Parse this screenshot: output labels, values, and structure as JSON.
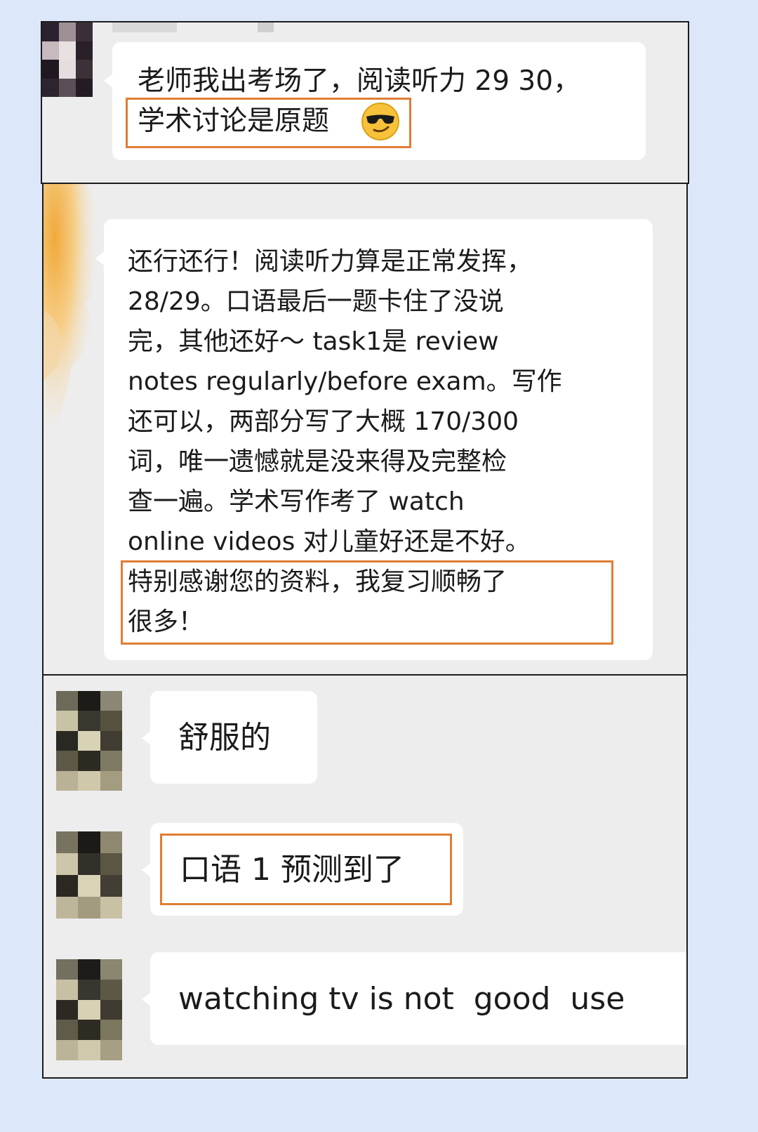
{
  "chat": {
    "message_1": {
      "lines": [
        "老师我出考场了，阅读听力 29 30，",
        "学术讨论是原题"
      ],
      "emoji": "sunglasses-face"
    },
    "message_2": {
      "lines": [
        "还行还行！阅读听力算是正常发挥，",
        "28/29。口语最后一题卡住了没说",
        "完，其他还好～ task1是 review",
        "notes regularly/before exam。写作",
        "还可以，两部分写了大概 170/300",
        "词，唯一遗憾就是没来得及完整检",
        "查一遍。学术写作考了 watch",
        "online videos 对儿童好还是不好。",
        "特别感谢您的资料，我复习顺畅了",
        "很多！"
      ]
    },
    "message_3": {
      "text": "舒服的"
    },
    "message_4": {
      "text": "口语 1 预测到了"
    },
    "message_5": {
      "text": "watching tv is not  good  use"
    }
  },
  "colors": {
    "page_background": "#dce8fa",
    "panel_background": "#ededed",
    "bubble": "#ffffff",
    "highlight_border": "#e07d34",
    "panel_border": "#1c1c1c"
  }
}
